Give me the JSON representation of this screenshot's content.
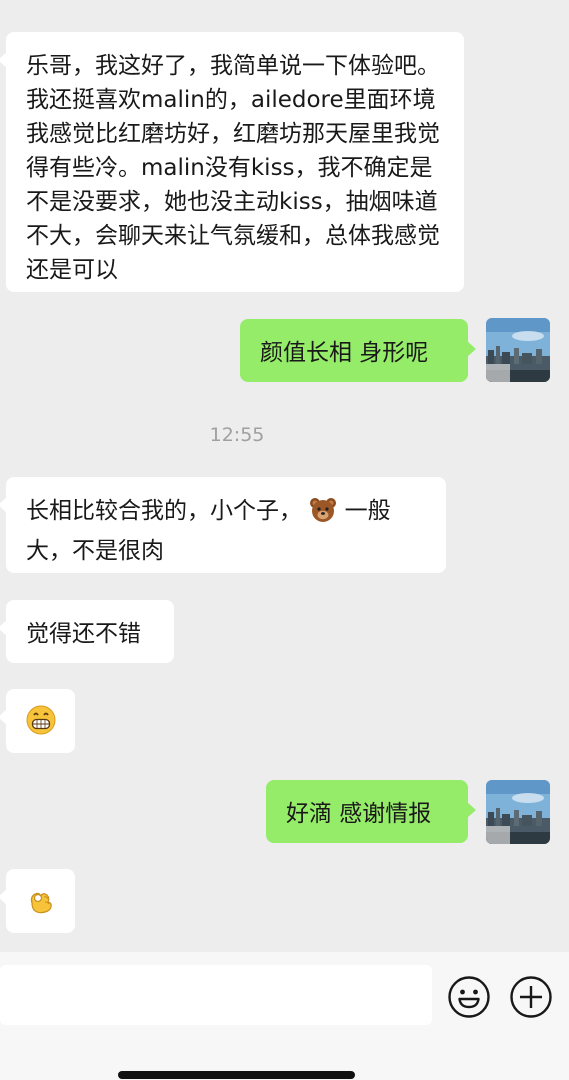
{
  "messages": {
    "m1": "乐哥，我这好了，我简单说一下体验吧。我还挺喜欢malin的，ailedore里面环境我感觉比红磨坊好，红磨坊那天屋里我觉得有些冷。malin没有kiss，我不确定是不是没要求，她也没主动kiss，抽烟味道不大，会聊天来让气氛缓和，总体我感觉还是可以",
    "m2": "颜值长相 身形呢",
    "timestamp": "12:55",
    "m3_before": "长相比较合我的，小个子，",
    "m3_after": "一般大，不是很肉",
    "m4": "觉得还不错",
    "m6": "好滴 感谢情报"
  },
  "icons": {
    "m3_emoji": "bear-face-emoji",
    "m5_emoji": "grinning-face-emoji",
    "m7_emoji": "ok-hand-emoji",
    "toolbar_left": "emoji-smile-icon",
    "toolbar_right": "plus-icon"
  },
  "colors": {
    "background": "#ededed",
    "incoming_bubble": "#ffffff",
    "outgoing_bubble": "#95ec69",
    "timestamp_text": "#a0a0a0"
  }
}
